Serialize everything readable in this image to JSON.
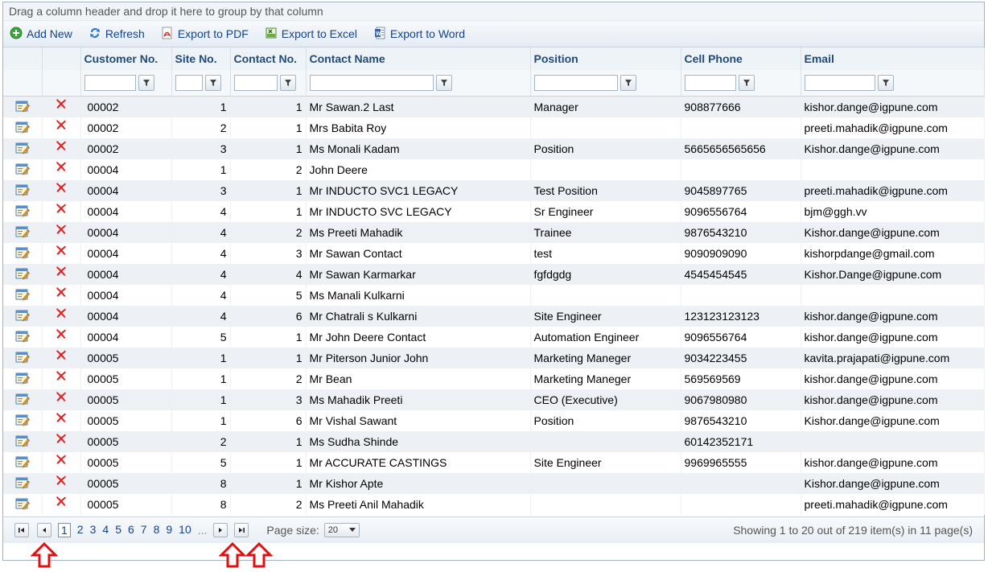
{
  "group_panel": {
    "text": "Drag a column header and drop it here to group by that column"
  },
  "toolbar": {
    "add_new": "Add New",
    "refresh": "Refresh",
    "export_pdf": "Export to PDF",
    "export_excel": "Export to Excel",
    "export_word": "Export to Word"
  },
  "columns": [
    "Customer No.",
    "Site No.",
    "Contact No.",
    "Contact Name",
    "Position",
    "Cell Phone",
    "Email"
  ],
  "rows": [
    {
      "customer": "00002",
      "site": "1",
      "contact": "1",
      "name": "Mr Sawan.2 Last",
      "position": "Manager",
      "phone": "908877666",
      "email": "kishor.dange@igpune.com"
    },
    {
      "customer": "00002",
      "site": "2",
      "contact": "1",
      "name": "Mrs Babita Roy",
      "position": "",
      "phone": "",
      "email": "preeti.mahadik@igpune.com"
    },
    {
      "customer": "00002",
      "site": "3",
      "contact": "1",
      "name": "Ms Monali Kadam",
      "position": "Position",
      "phone": "5665656565656",
      "email": "Kishor.dange@igpune.com"
    },
    {
      "customer": "00004",
      "site": "1",
      "contact": "2",
      "name": "John Deere",
      "position": "",
      "phone": "",
      "email": ""
    },
    {
      "customer": "00004",
      "site": "3",
      "contact": "1",
      "name": "Mr INDUCTO SVC1 LEGACY",
      "position": "Test Position",
      "phone": "9045897765",
      "email": "preeti.mahadik@igpune.com"
    },
    {
      "customer": "00004",
      "site": "4",
      "contact": "1",
      "name": "Mr INDUCTO SVC LEGACY",
      "position": "Sr Engineer",
      "phone": "9096556764",
      "email": "bjm@ggh.vv"
    },
    {
      "customer": "00004",
      "site": "4",
      "contact": "2",
      "name": "Ms Preeti Mahadik",
      "position": "Trainee",
      "phone": "9876543210",
      "email": "Kishor.dange@igpune.com"
    },
    {
      "customer": "00004",
      "site": "4",
      "contact": "3",
      "name": "Mr Sawan Contact",
      "position": "test",
      "phone": "9090909090",
      "email": "kishorpdange@gmail.com"
    },
    {
      "customer": "00004",
      "site": "4",
      "contact": "4",
      "name": "Mr Sawan Karmarkar",
      "position": "fgfdgdg",
      "phone": "4545454545",
      "email": "Kishor.Dange@igpune.com"
    },
    {
      "customer": "00004",
      "site": "4",
      "contact": "5",
      "name": "Ms Manali Kulkarni",
      "position": "",
      "phone": "",
      "email": ""
    },
    {
      "customer": "00004",
      "site": "4",
      "contact": "6",
      "name": "Mr Chatrali s Kulkarni",
      "position": "Site Engineer",
      "phone": "123123123123",
      "email": "kishor.dange@igpune.com"
    },
    {
      "customer": "00004",
      "site": "5",
      "contact": "1",
      "name": "Mr John Deere Contact",
      "position": "Automation Engineer",
      "phone": "9096556764",
      "email": "kishor.dange@igpune.com"
    },
    {
      "customer": "00005",
      "site": "1",
      "contact": "1",
      "name": "Mr Piterson Junior John",
      "position": "Marketing Maneger",
      "phone": "9034223455",
      "email": "kavita.prajapati@igpune.com"
    },
    {
      "customer": "00005",
      "site": "1",
      "contact": "2",
      "name": "Mr Bean",
      "position": "Marketing Maneger",
      "phone": "569569569",
      "email": "kishor.dange@igpune.com"
    },
    {
      "customer": "00005",
      "site": "1",
      "contact": "3",
      "name": "Ms Mahadik Preeti",
      "position": "CEO (Executive)",
      "phone": "9067980980",
      "email": "kishor.dange@igpune.com"
    },
    {
      "customer": "00005",
      "site": "1",
      "contact": "6",
      "name": "Mr Vishal Sawant",
      "position": "Position",
      "phone": "9876543210",
      "email": "Kishor.dange@igpune.com"
    },
    {
      "customer": "00005",
      "site": "2",
      "contact": "1",
      "name": "Ms Sudha Shinde",
      "position": "",
      "phone": "60142352171",
      "email": ""
    },
    {
      "customer": "00005",
      "site": "5",
      "contact": "1",
      "name": "Mr ACCURATE CASTINGS",
      "position": "Site Engineer",
      "phone": "9969965555",
      "email": "kishor.dange@igpune.com"
    },
    {
      "customer": "00005",
      "site": "8",
      "contact": "1",
      "name": "Mr Kishor Apte",
      "position": "",
      "phone": "",
      "email": "Kishor.dange@igpune.com"
    },
    {
      "customer": "00005",
      "site": "8",
      "contact": "2",
      "name": "Ms Preeti Anil Mahadik",
      "position": "",
      "phone": "",
      "email": "preeti.mahadik@igpune.com"
    }
  ],
  "pager": {
    "pages": [
      "1",
      "2",
      "3",
      "4",
      "5",
      "6",
      "7",
      "8",
      "9",
      "10"
    ],
    "current": "1",
    "ellipsis": "...",
    "page_size_label": "Page size:",
    "page_size_value": "20",
    "summary": "Showing 1 to 20 out of 219 item(s) in 11 page(s)"
  },
  "colors": {
    "accent": "#15428b",
    "header_text": "#1f4a7a",
    "alt_row": "#edf1f5",
    "delete_red": "#e02020",
    "annotation_arrow": "#e01010"
  },
  "icons": [
    "add-icon",
    "refresh-icon",
    "pdf-icon",
    "excel-icon",
    "word-icon",
    "filter-icon",
    "edit-icon",
    "delete-icon",
    "first-page-icon",
    "prev-page-icon",
    "next-page-icon",
    "last-page-icon",
    "dropdown-arrow-icon",
    "up-arrow-annotation-icon"
  ]
}
